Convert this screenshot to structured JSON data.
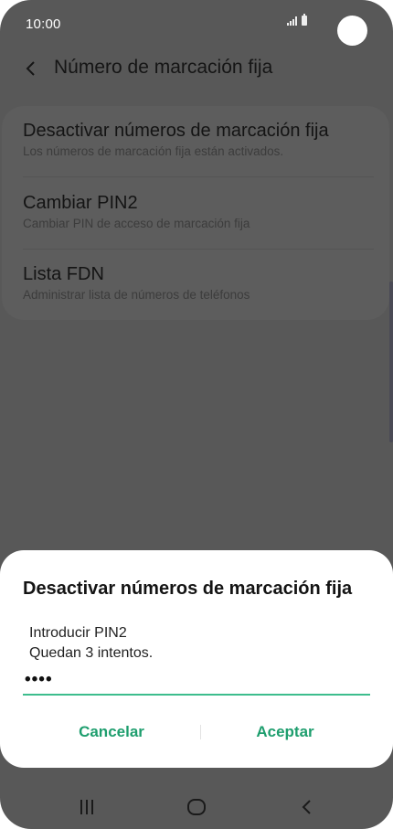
{
  "status_bar": {
    "time": "10:00"
  },
  "app_bar": {
    "title": "Número de marcación fija"
  },
  "settings": {
    "items": [
      {
        "title": "Desactivar números de marcación fija",
        "subtitle": "Los números de marcación fija están activados."
      },
      {
        "title": "Cambiar PIN2",
        "subtitle": "Cambiar PIN de acceso de marcación fija"
      },
      {
        "title": "Lista FDN",
        "subtitle": "Administrar lista de números de teléfonos"
      }
    ]
  },
  "dialog": {
    "title": "Desactivar números de marcación fija",
    "message_line1": "Introducir PIN2",
    "message_line2": "Quedan 3 intentos.",
    "pin_value": "••••",
    "cancel_label": "Cancelar",
    "accept_label": "Aceptar"
  },
  "navigation_bar": {
    "icons": [
      "recent-apps-icon",
      "home-icon",
      "back-icon"
    ]
  },
  "colors": {
    "accent": "#1e9e6e",
    "input_underline": "#3dbd8d",
    "dim_overlay": "#585858"
  }
}
